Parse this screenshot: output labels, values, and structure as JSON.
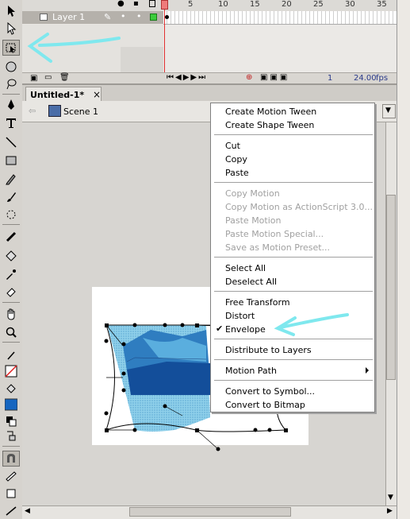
{
  "timeline": {
    "frame_numbers": [
      "5",
      "10",
      "15",
      "20",
      "25",
      "30",
      "35"
    ],
    "layer_name": "Layer 1",
    "status": {
      "frame": "1",
      "fps": "24.00",
      "fps_unit": "fps"
    }
  },
  "document": {
    "tab_title": "Untitled-1*",
    "tab_close": "×",
    "scene_name": "Scene 1"
  },
  "context_menu": {
    "items": [
      {
        "label": "Create Motion Tween",
        "enabled": true
      },
      {
        "label": "Create Shape Tween",
        "enabled": true
      },
      {
        "label": "Cut",
        "enabled": true
      },
      {
        "label": "Copy",
        "enabled": true
      },
      {
        "label": "Paste",
        "enabled": true
      },
      {
        "label": "Copy Motion",
        "enabled": false
      },
      {
        "label": "Copy Motion as ActionScript 3.0...",
        "enabled": false
      },
      {
        "label": "Paste Motion",
        "enabled": false
      },
      {
        "label": "Paste Motion Special...",
        "enabled": false
      },
      {
        "label": "Save as Motion Preset...",
        "enabled": false
      },
      {
        "label": "Select All",
        "enabled": true
      },
      {
        "label": "Deselect All",
        "enabled": true
      },
      {
        "label": "Free Transform",
        "enabled": true
      },
      {
        "label": "Distort",
        "enabled": true
      },
      {
        "label": "Envelope",
        "enabled": true,
        "checked": true
      },
      {
        "label": "Distribute to Layers",
        "enabled": true
      },
      {
        "label": "Motion Path",
        "enabled": true,
        "submenu": true
      },
      {
        "label": "Convert to Symbol...",
        "enabled": true
      },
      {
        "label": "Convert to Bitmap",
        "enabled": true
      }
    ],
    "check_mark": "✔"
  },
  "colors": {
    "annotation_arrow": "#7fe8ee",
    "fill_swatch": "#1565c0",
    "playhead": "#e03030"
  },
  "icons": {
    "tools": [
      "selection-icon",
      "subselection-icon",
      "free-transform-icon",
      "3d-rotation-icon",
      "lasso-icon",
      "pen-icon",
      "text-icon",
      "line-icon",
      "rectangle-icon",
      "pencil-icon",
      "brush-icon",
      "deco-icon",
      "bone-icon",
      "paint-bucket-icon",
      "eyedropper-icon",
      "eraser-icon",
      "hand-icon",
      "zoom-icon",
      "stroke-color-icon",
      "fill-color-icon",
      "swap-colors-icon",
      "snap-to-objects-icon"
    ]
  }
}
